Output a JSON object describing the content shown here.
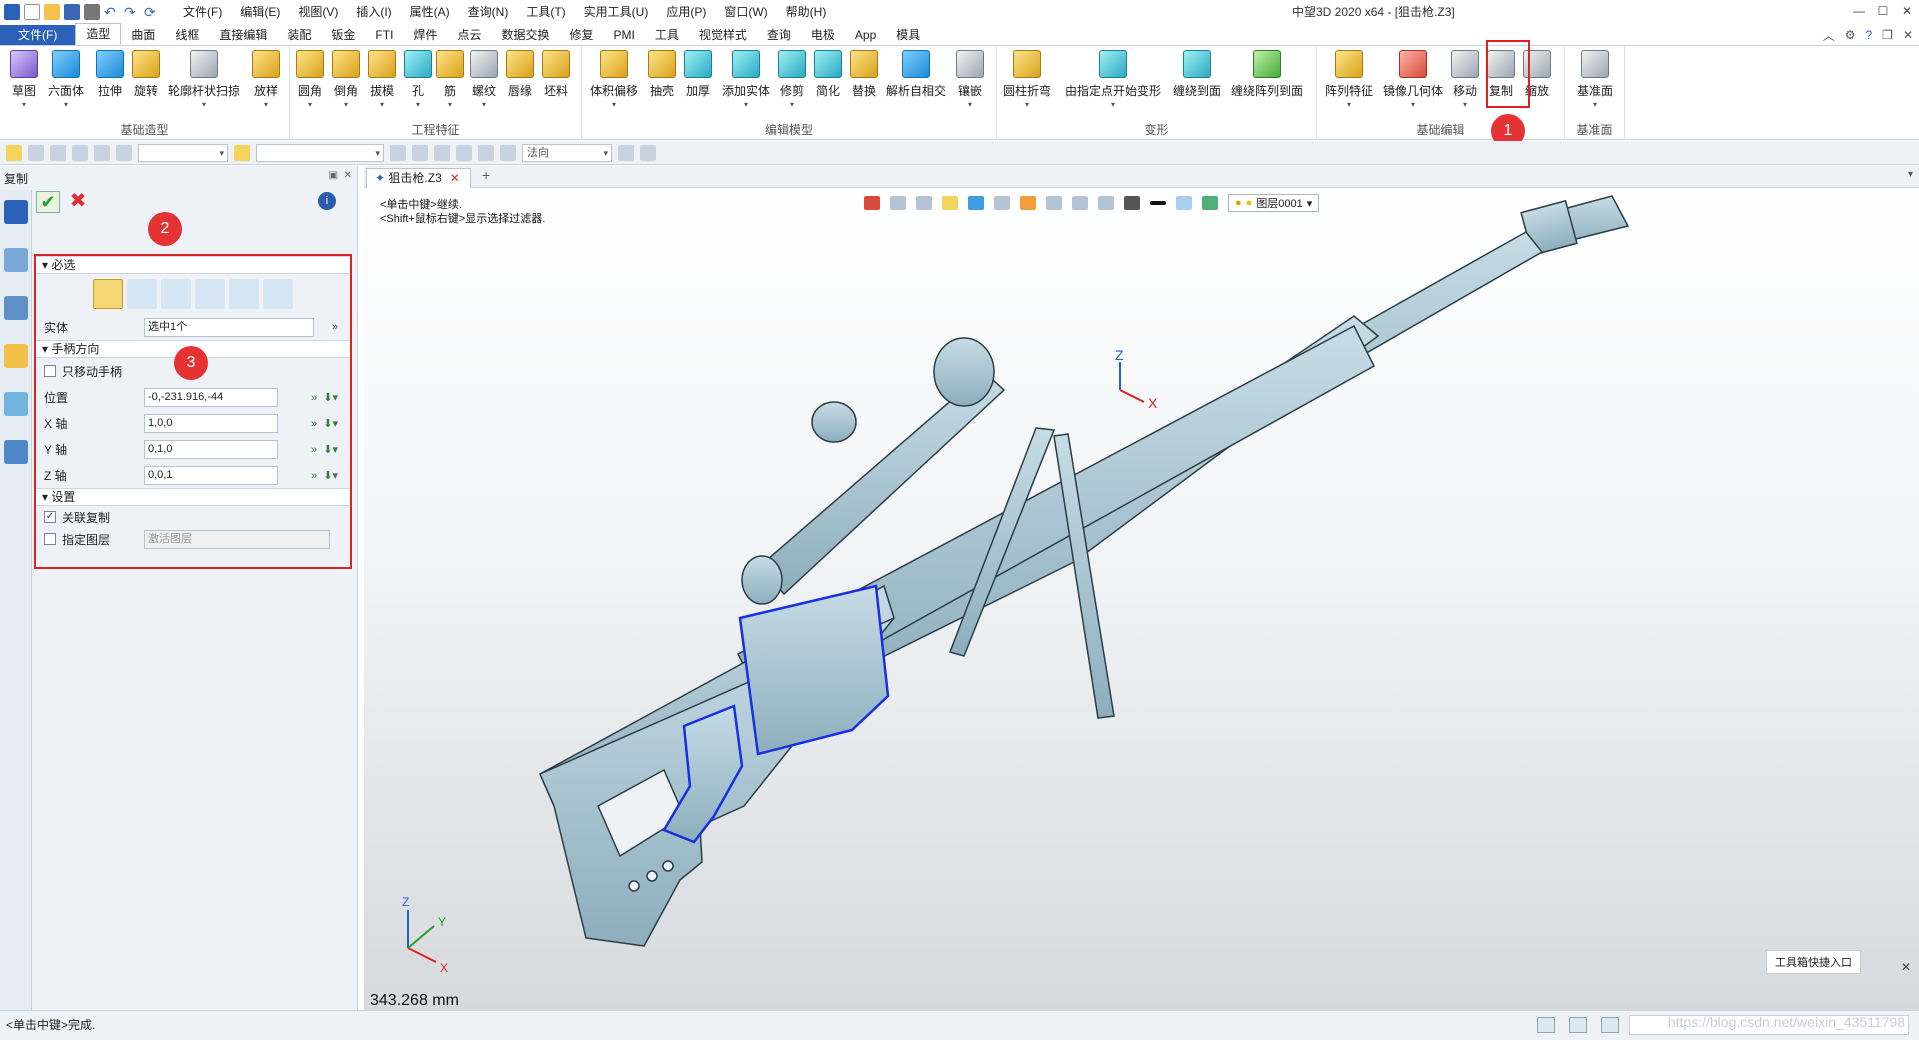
{
  "title_bar": {
    "menus": [
      "文件(F)",
      "编辑(E)",
      "视图(V)",
      "插入(I)",
      "属性(A)",
      "查询(N)",
      "工具(T)",
      "实用工具(U)",
      "应用(P)",
      "窗口(W)",
      "帮助(H)"
    ],
    "window_title": "中望3D 2020 x64 - [狙击枪.Z3]"
  },
  "tabs": [
    "文件(F)",
    "造型",
    "曲面",
    "线框",
    "直接编辑",
    "装配",
    "钣金",
    "FTI",
    "焊件",
    "点云",
    "数据交换",
    "修复",
    "PMI",
    "工具",
    "视觉样式",
    "查询",
    "电极",
    "App",
    "模具"
  ],
  "active_tab": "造型",
  "ribbon": {
    "groups": [
      {
        "label": "基础造型",
        "buttons": [
          "草图",
          "六面体",
          "拉伸",
          "旋转",
          "轮廓杆状扫掠",
          "放样"
        ]
      },
      {
        "label": "工程特征",
        "buttons": [
          "圆角",
          "倒角",
          "拔模",
          "孔",
          "筋",
          "螺纹",
          "唇缘",
          "坯料"
        ]
      },
      {
        "label": "编辑模型",
        "buttons": [
          "体积偏移",
          "抽壳",
          "加厚",
          "添加实体",
          "修剪",
          "简化",
          "替换",
          "解析自相交",
          "镶嵌"
        ]
      },
      {
        "label": "变形",
        "buttons": [
          "圆柱折弯",
          "由指定点开始变形",
          "缠绕到面",
          "缠绕阵列到面"
        ]
      },
      {
        "label": "基础编辑",
        "buttons": [
          "阵列特征",
          "镜像几何体",
          "移动",
          "复制",
          "缩放"
        ]
      },
      {
        "label": "基准面",
        "buttons": [
          "基准面"
        ]
      }
    ]
  },
  "toolbar2": {
    "filter_value": "法向"
  },
  "badges": [
    "1",
    "2",
    "3"
  ],
  "panel": {
    "title": "复制",
    "section_required": "必选",
    "solid_label": "实体",
    "solid_value": "选中1个",
    "section_handle": "手柄方向",
    "only_move_handle": "只移动手柄",
    "fields": [
      {
        "label": "位置",
        "value": "-0,-231.916,-44"
      },
      {
        "label": "X 轴",
        "value": "1,0,0"
      },
      {
        "label": "Y 轴",
        "value": "0,1,0"
      },
      {
        "label": "Z 轴",
        "value": "0,0,1"
      }
    ],
    "section_settings": "设置",
    "assoc_copy": "关联复制",
    "assign_layer": "指定图层",
    "layer_placeholder": "激活图层"
  },
  "viewport": {
    "doc_tab": "狙击枪.Z3",
    "hint1": "<单击中键>继续.",
    "hint2": "<Shift+鼠标右键>显示选择过滤器.",
    "layer": "图层0001",
    "scale": "343.268 mm",
    "toolbox": "工具箱快捷入口",
    "axis_x": "X",
    "axis_y": "Y",
    "axis_z": "Z"
  },
  "status": {
    "text": "<单击中键>完成.",
    "watermark": "https://blog.csdn.net/weixin_43511798"
  },
  "colors": {
    "accent": "#2b61b8",
    "highlight": "#e02020",
    "gun": "#a8c4d2",
    "selected": "#1a2fe0"
  }
}
